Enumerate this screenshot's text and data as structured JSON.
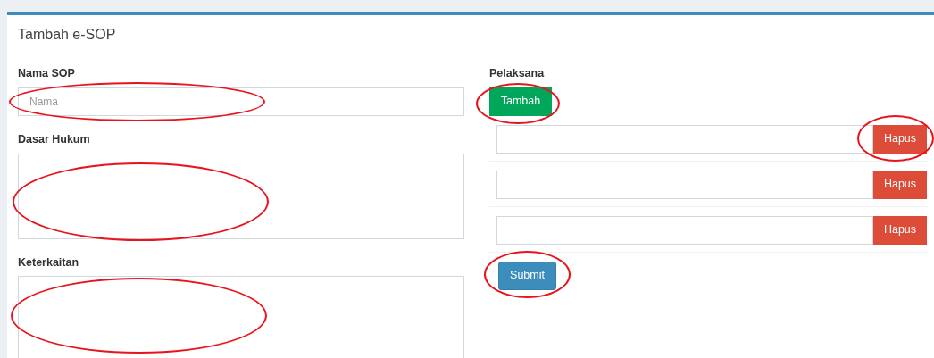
{
  "panel": {
    "title": "Tambah e-SOP"
  },
  "left": {
    "nama": {
      "label": "Nama SOP",
      "placeholder": "Nama",
      "circled": true
    },
    "dasar_hukum": {
      "label": "Dasar Hukum",
      "circled": true
    },
    "keterkaitan": {
      "label": "Keterkaitan",
      "circled": true
    }
  },
  "right": {
    "label": "Pelaksana",
    "add_button": {
      "label": "Tambah",
      "circled": true
    },
    "rows": [
      {
        "delete_label": "Hapus",
        "circled": true
      },
      {
        "delete_label": "Hapus",
        "circled": false
      },
      {
        "delete_label": "Hapus",
        "circled": false
      }
    ],
    "submit": {
      "label": "Submit",
      "circled": true
    }
  }
}
